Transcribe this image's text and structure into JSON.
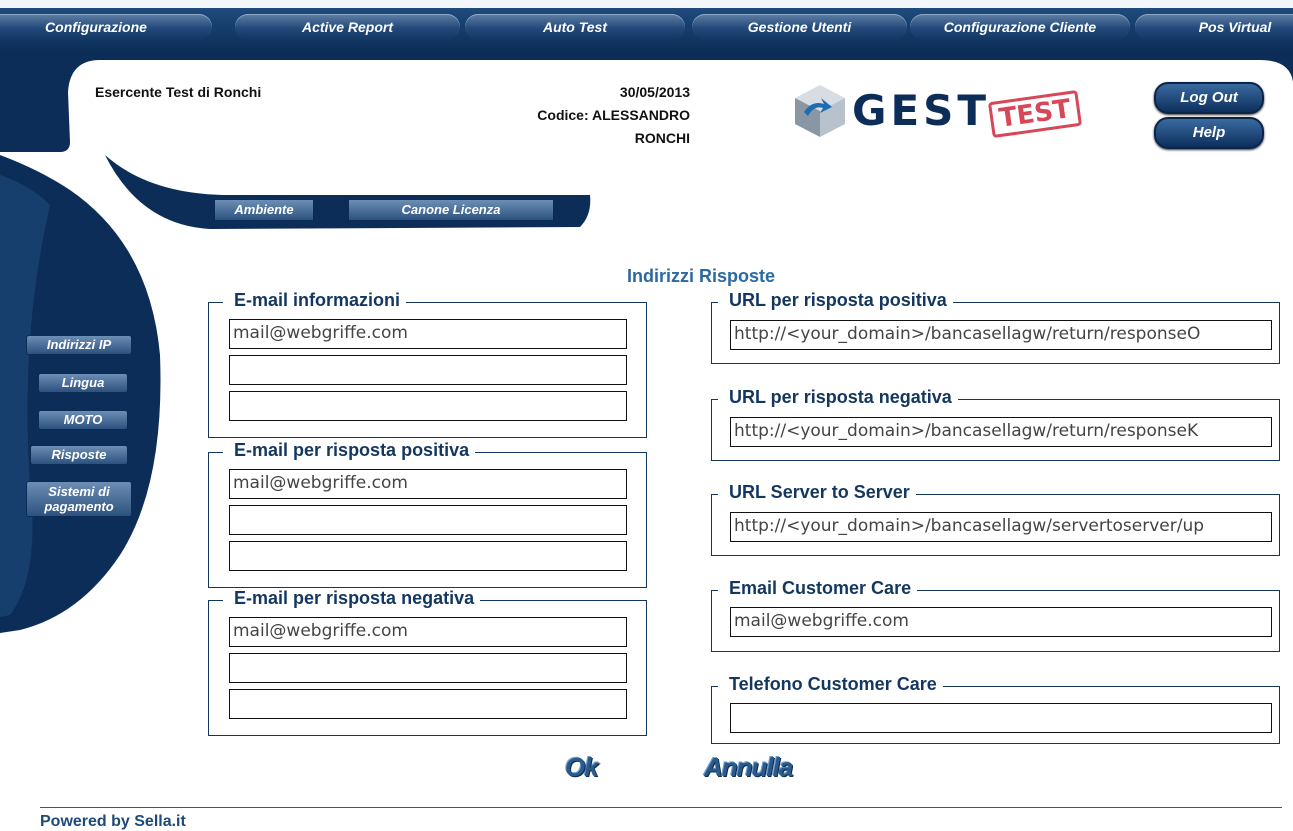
{
  "topnav": {
    "items": [
      "Configurazione",
      "Active Report",
      "Auto Test",
      "Gestione Utenti",
      "Configurazione Cliente",
      "Pos Virtual"
    ]
  },
  "header": {
    "merchant": "Esercente Test di Ronchi",
    "date": "30/05/2013",
    "code_line1": "Codice: ALESSANDRO",
    "code_line2": "RONCHI",
    "logo_text": "GEST",
    "logo_stamp": "TEST",
    "logout_label": "Log Out",
    "help_label": "Help"
  },
  "subtabs": [
    "Ambiente",
    "Canone Licenza"
  ],
  "sidebar": {
    "items": [
      "Indirizzi IP",
      "Lingua",
      "MOTO",
      "Risposte",
      "Sistemi di",
      "pagamento"
    ]
  },
  "main": {
    "title": "Indirizzi Risposte",
    "groups": {
      "email_info": {
        "legend": "E-mail informazioni",
        "values": [
          "mail@webgriffe.com",
          "",
          ""
        ]
      },
      "email_pos": {
        "legend": "E-mail per risposta positiva",
        "values": [
          "mail@webgriffe.com",
          "",
          ""
        ]
      },
      "email_neg": {
        "legend": "E-mail per risposta negativa",
        "values": [
          "mail@webgriffe.com",
          "",
          ""
        ]
      },
      "url_pos": {
        "legend": "URL per risposta positiva",
        "value": "http://<your_domain>/bancasellagw/return/responseO"
      },
      "url_neg": {
        "legend": "URL per risposta negativa",
        "value": "http://<your_domain>/bancasellagw/return/responseK"
      },
      "url_s2s": {
        "legend": "URL Server to Server",
        "value": "http://<your_domain>/bancasellagw/servertoserver/up"
      },
      "email_cc": {
        "legend": "Email Customer Care",
        "value": "mail@webgriffe.com"
      },
      "tel_cc": {
        "legend": "Telefono Customer Care",
        "value": ""
      }
    },
    "ok_label": "Ok",
    "cancel_label": "Annulla"
  },
  "footer": {
    "text": "Powered by Sella.it"
  },
  "colors": {
    "navy": "#0b2d57",
    "accent": "#2a6aa0",
    "stamp": "#d0283a"
  }
}
